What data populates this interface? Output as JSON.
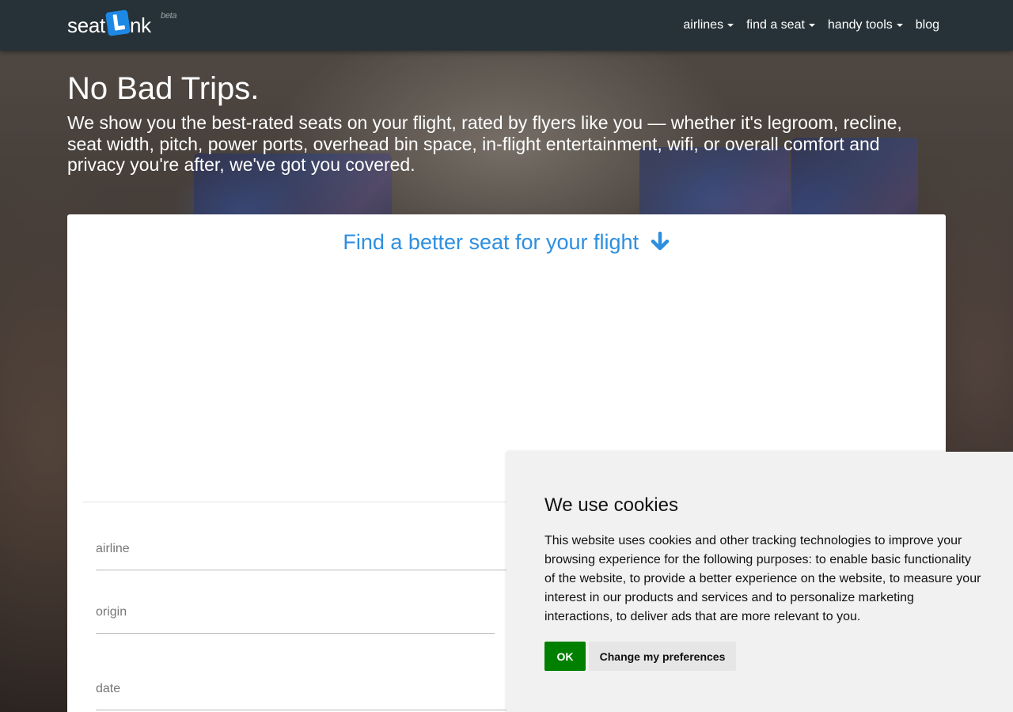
{
  "navbar": {
    "logo_text_left": "seat",
    "logo_text_right": "nk",
    "logo_badge": "beta",
    "items": [
      {
        "label": "airlines",
        "has_caret": true
      },
      {
        "label": "find a seat",
        "has_caret": true
      },
      {
        "label": "handy tools",
        "has_caret": true
      },
      {
        "label": "blog",
        "has_caret": false
      }
    ]
  },
  "hero": {
    "title": "No Bad Trips.",
    "subtitle": "We show you the best-rated seats on your flight, rated by flyers like you — whether it's legroom, recline, seat width, pitch, power ports, overhead bin space, in-flight entertainment, wifi, or overall comfort and privacy you're after, we've got you covered."
  },
  "search_card": {
    "heading": "Find a better seat for your flight",
    "heading_icon": "arrow-down-icon",
    "fields": [
      {
        "placeholder": "airline",
        "value": ""
      },
      {
        "placeholder": "origin",
        "value": ""
      },
      {
        "placeholder": "date",
        "value": ""
      }
    ]
  },
  "cookie_banner": {
    "title": "We use cookies",
    "text": "This website uses cookies and other tracking technologies to improve your browsing experience for the following purposes: to enable basic functionality of the website, to provide a better experience on the website, to measure your interest in our products and services and to personalize marketing interactions, to deliver ads that are more relevant to you.",
    "ok_label": "OK",
    "prefs_label": "Change my preferences"
  },
  "colors": {
    "navbar_bg": "#263238",
    "accent_blue": "#2d8fe0",
    "ok_green": "#008000"
  }
}
